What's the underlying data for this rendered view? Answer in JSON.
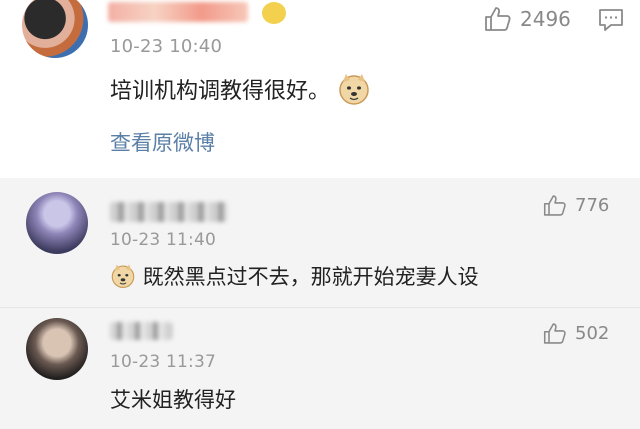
{
  "main_comment": {
    "time": "10-23 10:40",
    "text": "培训机构调教得很好。",
    "emoji": "doge-emoji",
    "likes": "2496",
    "view_original": "查看原微博"
  },
  "replies": [
    {
      "time": "10-23 11:40",
      "text": "既然黑点过不去，那就开始宠妻人设",
      "emoji": "doge-emoji",
      "likes": "776"
    },
    {
      "time": "10-23 11:37",
      "text": "艾米姐教得好",
      "likes": "502"
    }
  ],
  "icons": {
    "like": "thumbs-up-icon",
    "reply": "comment-icon",
    "emoji": "doge-emoji"
  },
  "colors": {
    "link": "#5b7fa6",
    "reply_bg": "#f4f4f4",
    "meta": "#999999"
  }
}
